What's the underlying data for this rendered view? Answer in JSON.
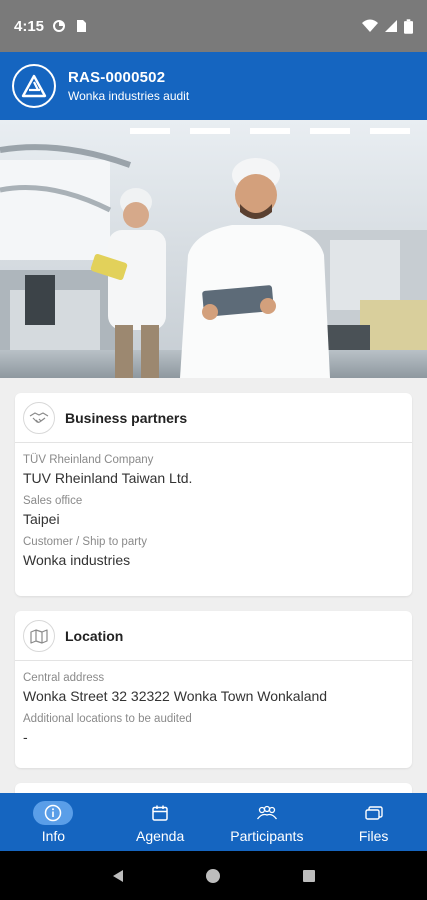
{
  "status_bar": {
    "time": "4:15",
    "icons": [
      "data-saver-icon",
      "sim-card-icon",
      "wifi-icon",
      "signal-icon",
      "battery-icon"
    ]
  },
  "header": {
    "title": "RAS-0000502",
    "subtitle": "Wonka industries audit",
    "logo_icon": "tuv-logo-icon"
  },
  "hero": {
    "image": "factory-workers-photo"
  },
  "cards": {
    "business_partners": {
      "title": "Business partners",
      "icon": "handshake-icon",
      "fields": [
        {
          "label": "TÜV Rheinland Company",
          "value": "TUV Rheinland Taiwan Ltd."
        },
        {
          "label": "Sales office",
          "value": "Taipei"
        },
        {
          "label": "Customer / Ship to party",
          "value": "Wonka industries"
        }
      ]
    },
    "location": {
      "title": "Location",
      "icon": "map-icon",
      "fields": [
        {
          "label": "Central address",
          "value": "Wonka Street 32 32322 Wonka Town Wonkaland"
        },
        {
          "label": "Additional locations to be audited",
          "value": "-"
        }
      ]
    }
  },
  "bottom_nav": {
    "items": [
      {
        "label": "Info",
        "icon": "info-icon",
        "active": true
      },
      {
        "label": "Agenda",
        "icon": "calendar-icon",
        "active": false
      },
      {
        "label": "Participants",
        "icon": "people-icon",
        "active": false
      },
      {
        "label": "Files",
        "icon": "files-icon",
        "active": false
      }
    ]
  },
  "colors": {
    "primary": "#1565c0",
    "active_pill": "#5a9ee8",
    "status_bar": "#7a7a7a",
    "background": "#efefef"
  }
}
